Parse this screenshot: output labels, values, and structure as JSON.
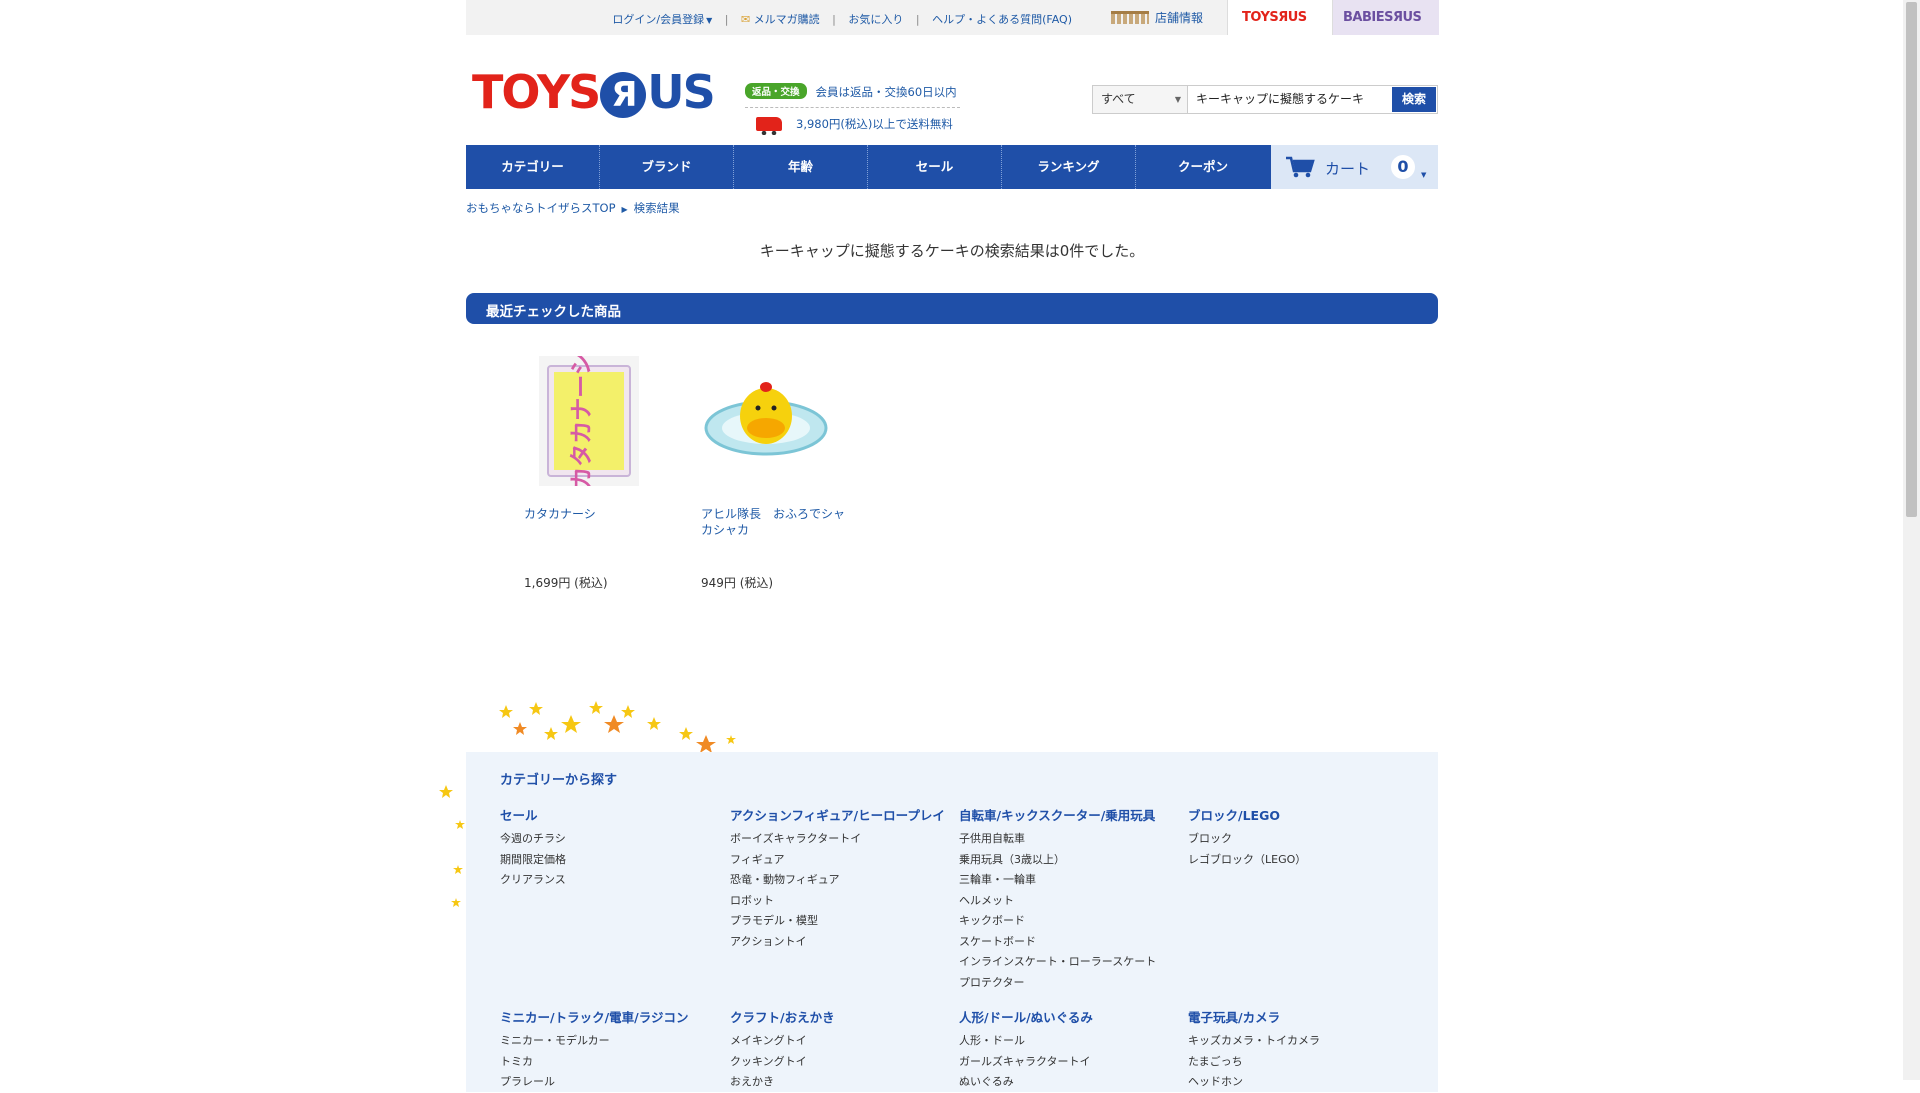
{
  "topbar": {
    "links": [
      "ログイン/会員登録",
      "メルマガ購読",
      "お気に入り",
      "ヘルプ・よくある質問(FAQ)"
    ],
    "store_info": "店舗情報",
    "tab_toys": "TOYSЯUS",
    "tab_babies": "BABIESЯUS"
  },
  "logo": {
    "text_left": "TOYS",
    "text_r": "Я",
    "text_right": "US"
  },
  "promo": {
    "badge": "返品・交換",
    "line1": "会員は返品・交換60日以内",
    "line2": "3,980円(税込)以上で送料無料"
  },
  "search": {
    "category": "すべて",
    "query": "キーキャップに擬態するケーキ",
    "button": "検索"
  },
  "nav": [
    "カテゴリー",
    "ブランド",
    "年齢",
    "セール",
    "ランキング",
    "クーポン"
  ],
  "cart": {
    "label": "カート",
    "count": "0"
  },
  "breadcrumb": {
    "home": "おもちゃならトイザらスTOP",
    "current": "検索結果"
  },
  "result_text": "キーキャップに擬態するケーキの検索結果は0件でした。",
  "recent": {
    "title": "最近チェックした商品",
    "products": [
      {
        "name": "カタカナーシ",
        "price": "1,699円 (税込)",
        "box_text": "カタカナーシ"
      },
      {
        "name": "アヒル隊長　おふろでシャカシャカ",
        "price": "949円 (税込)"
      }
    ]
  },
  "footer": {
    "title": "カテゴリーから探す",
    "columns": [
      {
        "heading": "セール",
        "links": [
          "今週のチラシ",
          "期間限定価格",
          "クリアランス"
        ]
      },
      {
        "heading": "アクションフィギュア/ヒーロープレイ",
        "links": [
          "ボーイズキャラクタートイ",
          "フィギュア",
          "恐竜・動物フィギュア",
          "ロボット",
          "プラモデル・模型",
          "アクショントイ"
        ]
      },
      {
        "heading": "自転車/キックスクーター/乗用玩具",
        "links": [
          "子供用自転車",
          "乗用玩具（3歳以上）",
          "三輪車・一輪車",
          "ヘルメット",
          "キックボード",
          "スケートボード",
          "インラインスケート・ローラースケート",
          "プロテクター"
        ]
      },
      {
        "heading": "ブロック/LEGO",
        "links": [
          "ブロック",
          "レゴブロック（LEGO）"
        ]
      },
      {
        "heading": "ミニカー/トラック/電車/ラジコン",
        "links": [
          "ミニカー・モデルカー",
          "トミカ",
          "プラレール"
        ]
      },
      {
        "heading": "クラフト/おえかき",
        "links": [
          "メイキングトイ",
          "クッキングトイ",
          "おえかき"
        ]
      },
      {
        "heading": "人形/ドール/ぬいぐるみ",
        "links": [
          "人形・ドール",
          "ガールズキャラクタートイ",
          "ぬいぐるみ"
        ]
      },
      {
        "heading": "電子玩具/カメラ",
        "links": [
          "キッズカメラ・トイカメラ",
          "たまごっち",
          "ヘッドホン"
        ]
      }
    ]
  },
  "colors": {
    "brand_blue": "#1f4fa8",
    "link_blue": "#1f5aa6",
    "badge_green": "#49a52a"
  }
}
